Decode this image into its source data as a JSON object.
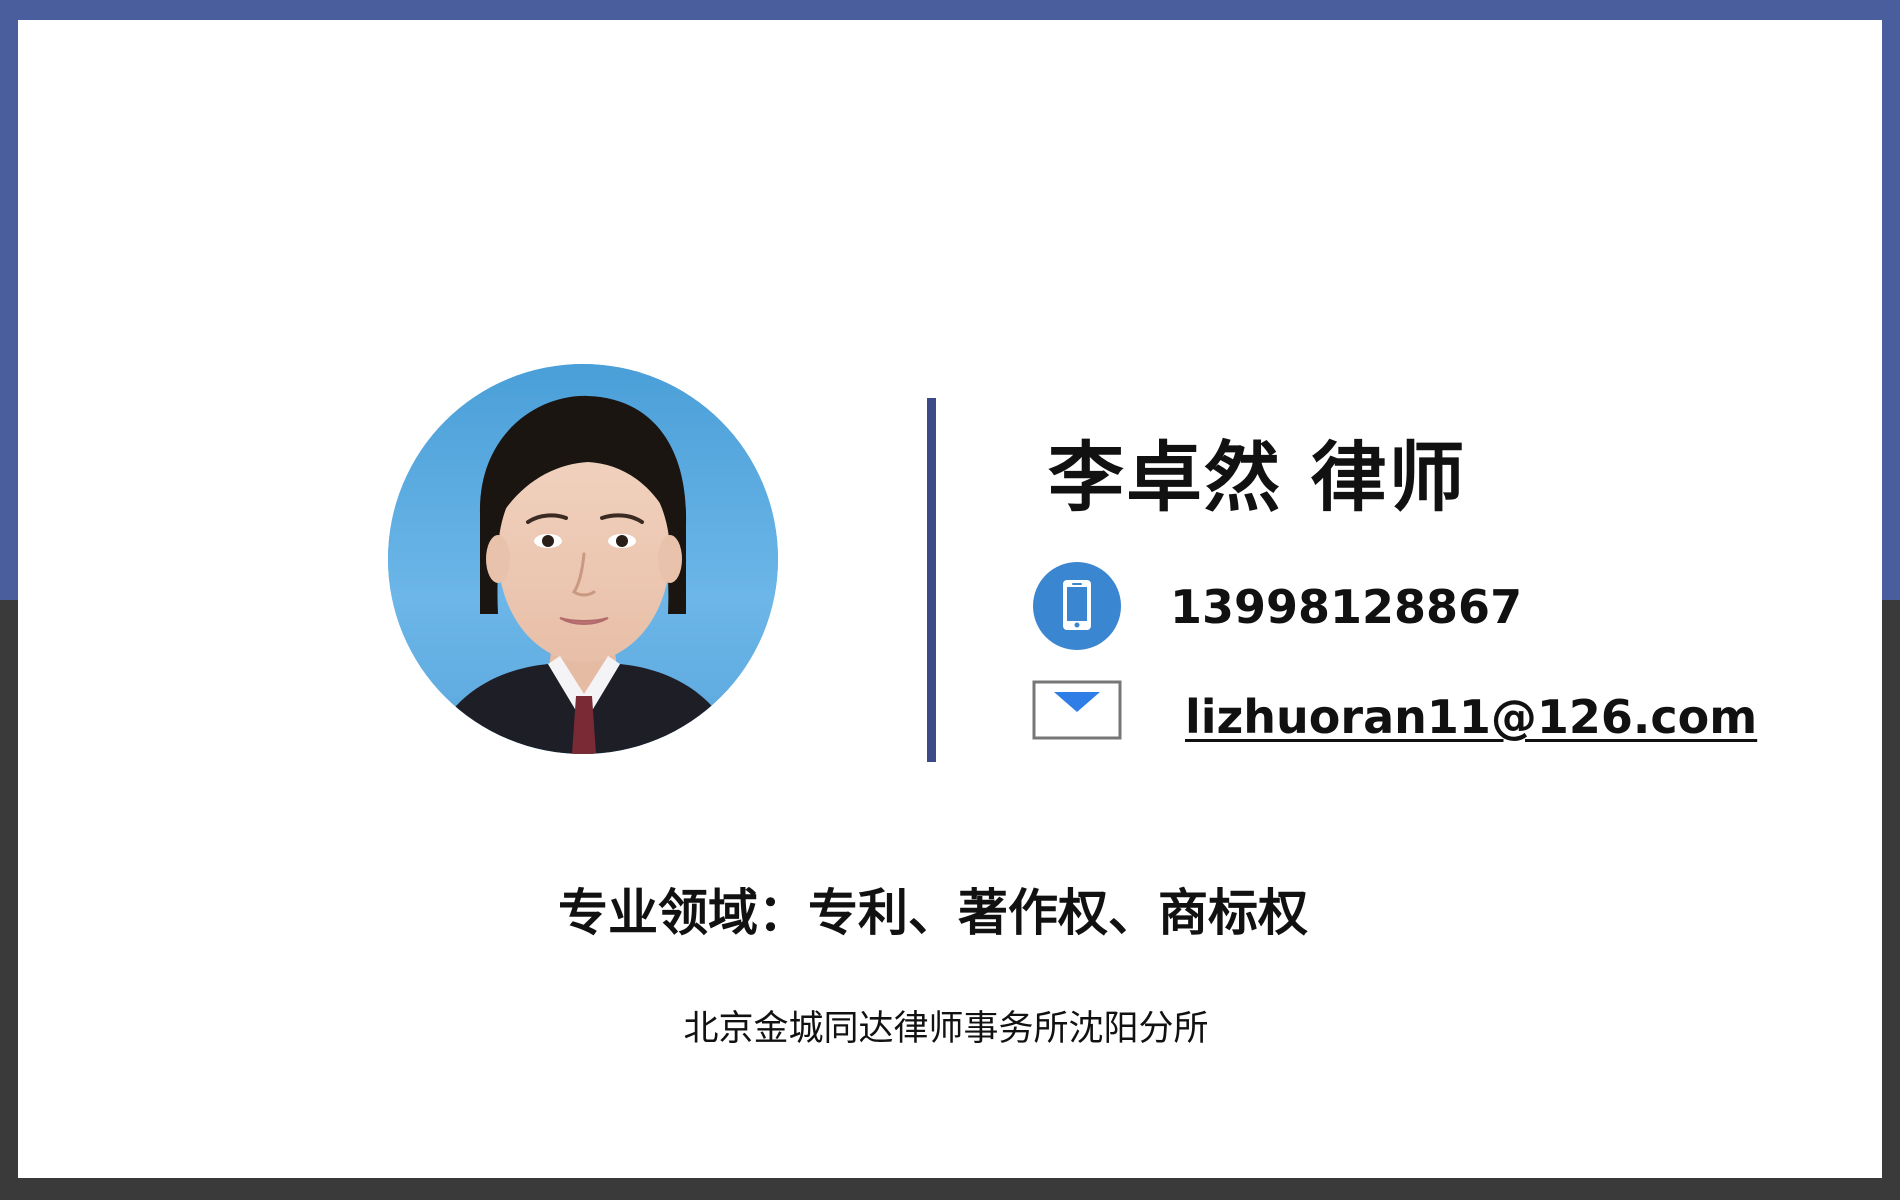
{
  "colors": {
    "frame_top": "#4a5d9c",
    "frame_bottom": "#3a3a3a",
    "card_bg": "#ffffff",
    "divider": "#3d4a88",
    "phone_icon_bg": "#3b86d0",
    "mail_accent": "#2f7de6"
  },
  "profile": {
    "avatar": "portrait-photo",
    "name": "李卓然 律师"
  },
  "contact": {
    "phone_icon": "mobile-phone-icon",
    "phone": "13998128867",
    "mail_icon": "envelope-icon",
    "email": "lizhuoran11@126.com"
  },
  "expertise": "专业领域：专利、著作权、商标权",
  "firm": "北京金城同达律师事务所沈阳分所"
}
